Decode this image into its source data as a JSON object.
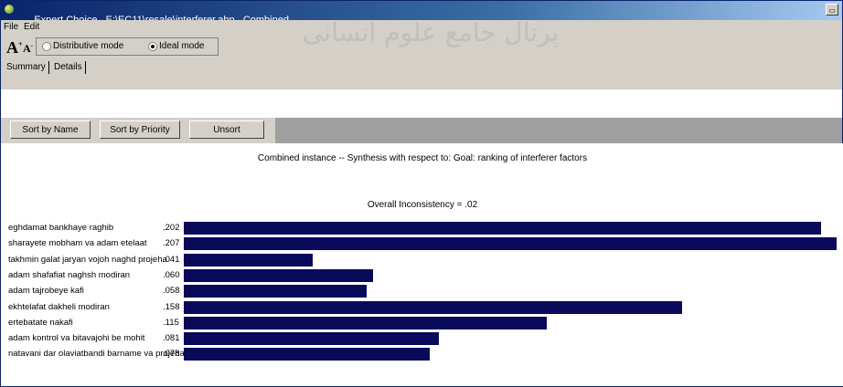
{
  "window": {
    "app_name": "Expert Choice",
    "file_path": "E:\\EC11\\resale\\interferer.ahp",
    "mode_tag": "Combined"
  },
  "menu": [
    "File",
    "Edit"
  ],
  "mode": {
    "distributive_label": "Distributive mode",
    "ideal_label": "Ideal mode",
    "selected": "Ideal mode"
  },
  "tabs": [
    "Summary",
    "Details"
  ],
  "sort_buttons": [
    "Sort by Name",
    "Sort by Priority",
    "Unsort"
  ],
  "heading": "Combined instance -- Synthesis with respect to: Goal: ranking of interferer factors",
  "inconsistency": "Overall Inconsistency = .02",
  "watermark": "پرتال جامع علوم انسانی",
  "colors": {
    "bar": "#0a0a5a",
    "titlebar": "#0a246a"
  },
  "chart_data": {
    "type": "bar",
    "orientation": "horizontal",
    "categories": [
      "eghdamat bankhaye raghib",
      "sharayete mobham va adam etelaat",
      "takhmin galat jaryan vojoh naghd projeha",
      "adam shafafiat naghsh modiran",
      "adam tajrobeye kafi",
      "ekhtelafat dakheli modiran",
      "ertebatate nakafi",
      "adam kontrol va bitavajohi be mohit",
      "natavani dar olaviatbandi barname va projeha"
    ],
    "values": [
      0.202,
      0.207,
      0.041,
      0.06,
      0.058,
      0.158,
      0.115,
      0.081,
      0.078
    ],
    "value_labels": [
      ".202",
      ".207",
      ".041",
      ".060",
      ".058",
      ".158",
      ".115",
      ".081",
      ".078"
    ],
    "xlim": [
      0,
      0.207
    ],
    "grid": false
  }
}
